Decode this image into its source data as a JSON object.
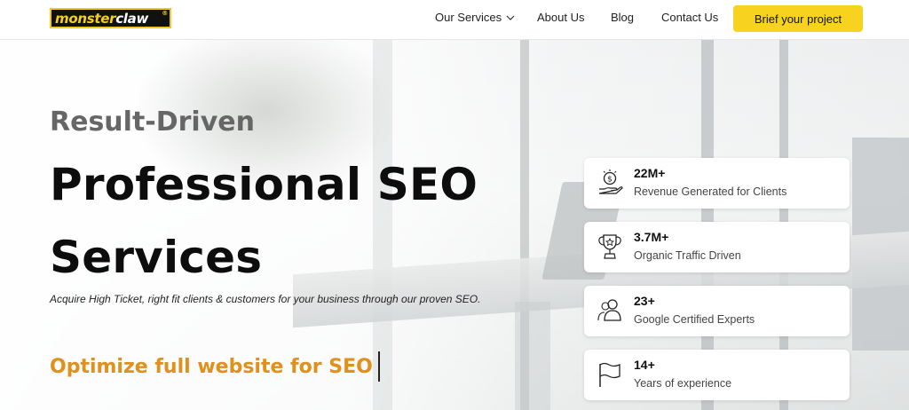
{
  "header": {
    "logo": {
      "part1": "monster",
      "part2": "claw",
      "mark": "®"
    },
    "nav": [
      {
        "label": "Our Services",
        "icon": "chevron-down-icon"
      },
      {
        "label": "About Us"
      },
      {
        "label": "Blog"
      },
      {
        "label": "Contact Us"
      }
    ],
    "cta_label": "Brief your project"
  },
  "hero": {
    "kicker": "Result-Driven",
    "headline_line1": "Professional SEO",
    "headline_line2": "Services",
    "subtext": "Acquire High Ticket, right fit clients & customers for your business through our proven SEO.",
    "typed_text": "Optimize full website for SEO"
  },
  "stats": [
    {
      "value": "22M+",
      "label": "Revenue Generated for Clients",
      "icon": "money-hand-icon"
    },
    {
      "value": "3.7M+",
      "label": "Organic Traffic Driven",
      "icon": "trophy-icon"
    },
    {
      "value": "23+",
      "label": "Google Certified Experts",
      "icon": "users-icon"
    },
    {
      "value": "14+",
      "label": "Years of experience",
      "icon": "flag-icon"
    }
  ],
  "colors": {
    "brand_yellow": "#f7d21f",
    "accent_orange": "#e0901c",
    "text_dark": "#0d0d0d",
    "text_grey": "#666666"
  }
}
